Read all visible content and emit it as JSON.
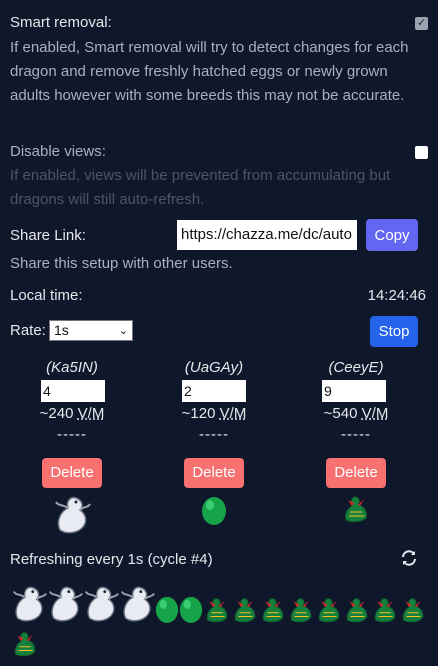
{
  "smart_removal": {
    "label": "Smart removal:",
    "checked": true,
    "description": "If enabled, Smart removal will try to detect changes for each dragon and remove freshly hatched eggs or newly grown adults however with some breeds this may not be accurate."
  },
  "disable_views": {
    "label": "Disable views:",
    "checked": false,
    "description": "If enabled, views will be prevented from accumulating but dragons will still auto-refresh."
  },
  "share": {
    "label": "Share Link:",
    "value": "https://chazza.me/dc/auto",
    "copy_label": "Copy",
    "hint": "Share this setup with other users."
  },
  "local_time": {
    "label": "Local time:",
    "value": "14:24:46"
  },
  "rate": {
    "label": "Rate:",
    "selected": "1s",
    "stop_label": "Stop"
  },
  "dragons": [
    {
      "code": "(Ka5IN)",
      "count": "4",
      "approx": "~240",
      "unit": "V/M",
      "dash": "-----",
      "delete_label": "Delete",
      "sprite": "white-dragon"
    },
    {
      "code": "(UaGAy)",
      "count": "2",
      "approx": "~120",
      "unit": "V/M",
      "dash": "-----",
      "delete_label": "Delete",
      "sprite": "green-egg"
    },
    {
      "code": "(CeeyE)",
      "count": "9",
      "approx": "~540",
      "unit": "V/M",
      "dash": "-----",
      "delete_label": "Delete",
      "sprite": "green-hatchling"
    }
  ],
  "status": {
    "text": "Refreshing every 1s (cycle #4)",
    "icon": "refresh-icon"
  },
  "sprite_strip": [
    "white-dragon",
    "white-dragon",
    "white-dragon",
    "white-dragon",
    "green-egg",
    "green-egg",
    "green-hatchling",
    "green-hatchling",
    "green-hatchling",
    "green-hatchling",
    "green-hatchling",
    "green-hatchling",
    "green-hatchling",
    "green-hatchling",
    "green-hatchling"
  ],
  "colors": {
    "background": "#0f172a",
    "copy_button": "#6366f1",
    "stop_button": "#2563eb",
    "delete_button": "#f87171"
  }
}
